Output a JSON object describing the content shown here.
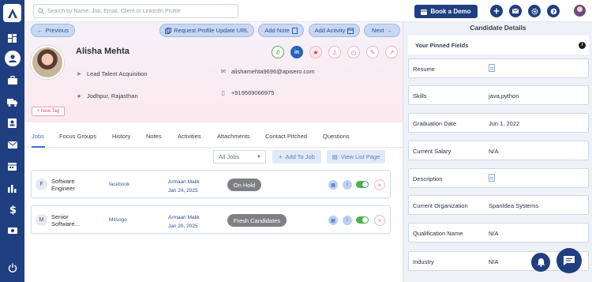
{
  "topbar": {
    "search_placeholder": "Search by Name, Job, Email, Client or LinkedIn Profile",
    "book_demo_label": "Book a Demo"
  },
  "nav": {
    "previous_label": "Previous",
    "request_update_label": "Request Profile Update URL",
    "add_note_label": "Add Note",
    "add_activity_label": "Add Activity",
    "next_label": "Next"
  },
  "candidate": {
    "name": "Alisha Mehta",
    "title": "Lead Talent Acquisition",
    "location": "Jodhpur, Rajasthan",
    "email": "alishamehta9696@apisero.com",
    "phone": "+919569066975",
    "new_tag_label": "+ New Tag"
  },
  "tabs": [
    "Jobs",
    "Focus Groups",
    "History",
    "Notes",
    "Activities",
    "Attachments",
    "Contact Pitched",
    "Questions"
  ],
  "jobs_toolbar": {
    "filter_value": "All Jobs",
    "add_to_job_label": "Add To Job",
    "view_list_label": "View List Page"
  },
  "jobs": [
    {
      "initial": "F",
      "title_line1": "Software",
      "title_line2": "Engineer",
      "client": "facebook",
      "recruiter": "Armaan Malik",
      "date": "Jan 24, 2025",
      "status": "On Hold"
    },
    {
      "initial": "M",
      "title_line1": "Senior",
      "title_line2": "Software...",
      "client": "Mitsogo",
      "recruiter": "Armaan Malik",
      "date": "Jan 20, 2025",
      "status": "Fresh Candidates"
    }
  ],
  "details": {
    "title": "Candidate Details",
    "pinned_label": "Your Pinned Fields",
    "fields": [
      {
        "label": "Resume",
        "value": ""
      },
      {
        "label": "Skills",
        "value": "java,python"
      },
      {
        "label": "Graduation Date",
        "value": "Jun 1, 2022"
      },
      {
        "label": "Current Salary",
        "value": "N/A"
      },
      {
        "label": "Description",
        "value": ""
      },
      {
        "label": "Current Organization",
        "value": "SpanIdea Systems"
      },
      {
        "label": "Qualification Name",
        "value": "N/A"
      },
      {
        "label": "Industry",
        "value": "N/A"
      }
    ]
  },
  "colors": {
    "brand": "#1f3f80",
    "accent": "#3d6fd6",
    "toggle_on": "#4caf50",
    "status_gray": "#7f8084"
  }
}
